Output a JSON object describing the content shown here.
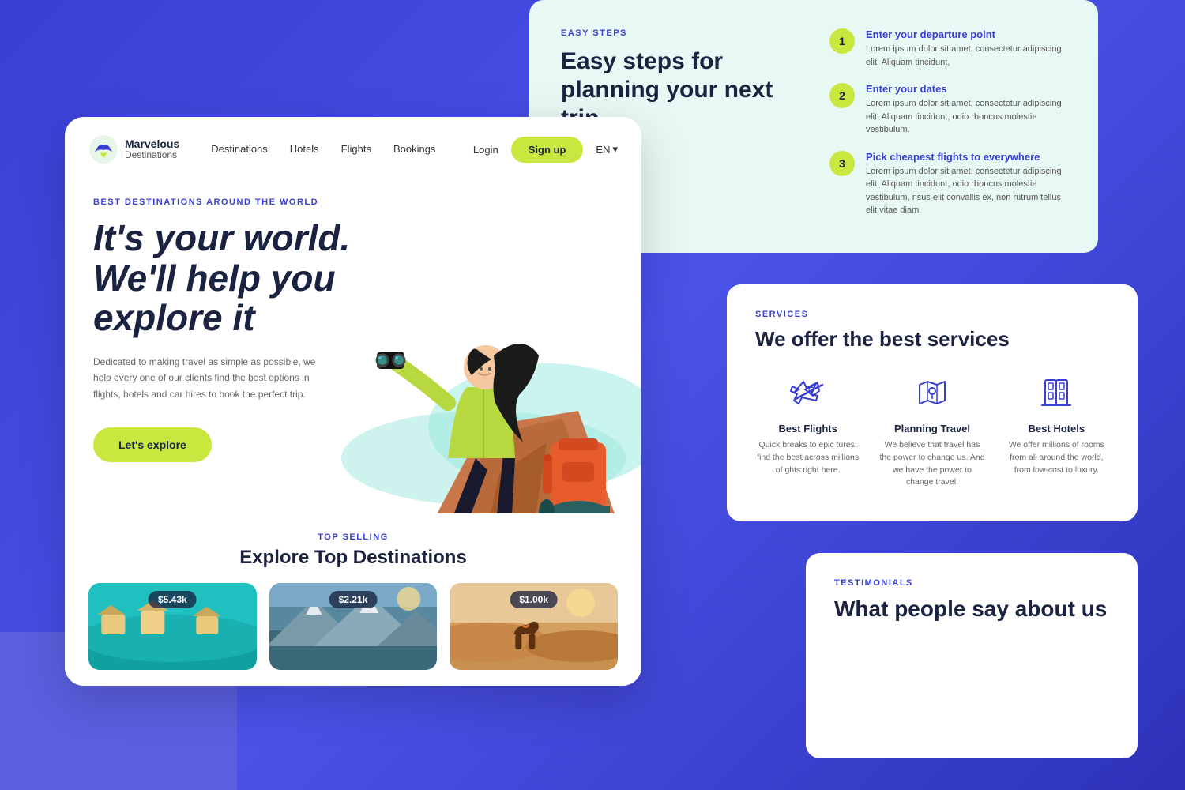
{
  "background": {
    "color": "#3a3fd4"
  },
  "easySteps": {
    "tag": "EASY STEPS",
    "title": "Easy steps for planning your next trip",
    "steps": [
      {
        "num": "1",
        "heading": "Enter your departure point",
        "desc": "Lorem ipsum dolor sit amet, consectetur adipiscing elit. Aliquam tincidunt,"
      },
      {
        "num": "2",
        "heading": "Enter your dates",
        "desc": "Lorem ipsum dolor sit amet, consectetur adipiscing elit. Aliquam tincidunt, odio rhoncus molestie vestibulum."
      },
      {
        "num": "3",
        "heading": "Pick cheapest flights to everywhere",
        "desc": "Lorem ipsum dolor sit amet, consectetur adipiscing elit. Aliquam tincidunt, odio rhoncus molestie vestibulum, risus elit convallis ex, non rutrum tellus elit vitae diam."
      }
    ]
  },
  "services": {
    "tag": "SERVICES",
    "title": "e offer the best services",
    "items": [
      {
        "icon": "plane-icon",
        "name": "Best Flights",
        "desc": "Quick breaks to epic tures, find the best across millions of ghts right here."
      },
      {
        "icon": "map-icon",
        "name": "Planning Travel",
        "desc": "We believe that travel has the power to change us. And we have the power to change travel."
      },
      {
        "icon": "hotel-icon",
        "name": "Best Hotels",
        "desc": "We offer millions of rooms from all around the world, from low-cost to luxury."
      }
    ]
  },
  "testimonials": {
    "tag": "TESTIMONIALS",
    "title": "What people say about us"
  },
  "nav": {
    "logo": {
      "name": "Marvelous",
      "sub": "Destinations"
    },
    "links": [
      "Destinations",
      "Hotels",
      "Flights",
      "Bookings"
    ],
    "login": "Login",
    "signup": "Sign up",
    "lang": "EN"
  },
  "hero": {
    "tag": "BEST DESTINATIONS AROUND THE WORLD",
    "title": "It's your world. We'll help you explore it",
    "desc": "Dedicated to making travel as simple as possible, we help every one of our clients find the best options in flights, hotels and car hires to book the perfect trip.",
    "cta": "Let's explore"
  },
  "topSelling": {
    "tag": "TOP SELLING",
    "title": "Explore Top Destinations",
    "destinations": [
      {
        "price": "$5.43k",
        "color1": "#40c4c4",
        "color2": "#20b2aa"
      },
      {
        "price": "$2.21k",
        "color1": "#7b9e6b",
        "color2": "#5a8a5a"
      },
      {
        "price": "$1.00k",
        "color1": "#d4a05a",
        "color2": "#c8884a"
      }
    ]
  }
}
